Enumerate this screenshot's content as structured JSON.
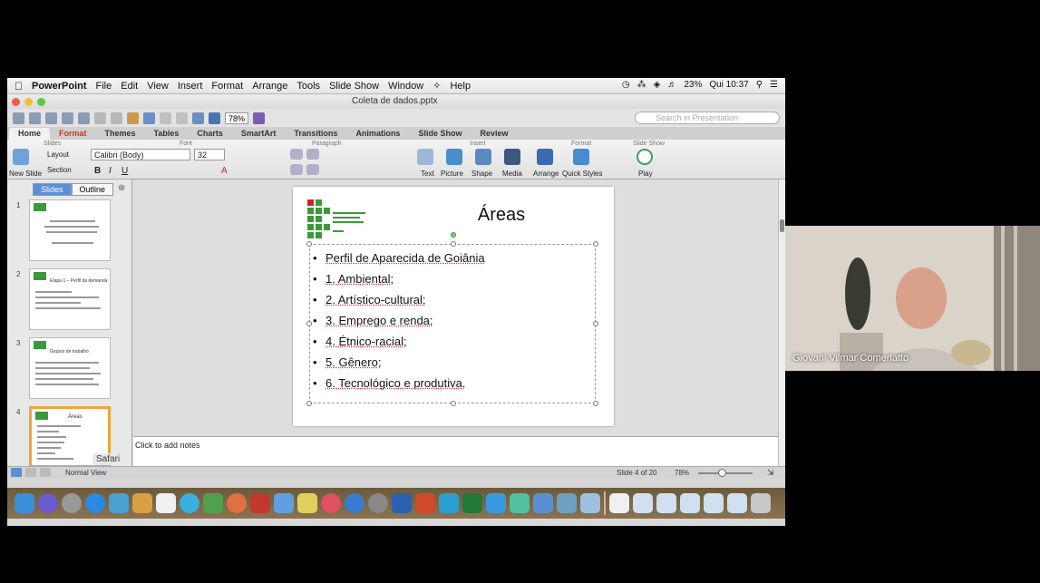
{
  "menubar": {
    "app": "PowerPoint",
    "items": [
      "File",
      "Edit",
      "View",
      "Insert",
      "Format",
      "Arrange",
      "Tools",
      "Slide Show",
      "Window",
      "Help"
    ],
    "battery": "23%",
    "clock": "Qui 10:37"
  },
  "window": {
    "doc_title": "Coleta de dados.pptx"
  },
  "toolbar": {
    "zoom": "78%",
    "search_placeholder": "Search in Presentation"
  },
  "ribbon": {
    "tabs": [
      "Home",
      "Format",
      "Themes",
      "Tables",
      "Charts",
      "SmartArt",
      "Transitions",
      "Animations",
      "Slide Show",
      "Review"
    ],
    "groups": {
      "slides": "Slides",
      "font": "Font",
      "paragraph": "Paragraph",
      "insert": "Insert",
      "format": "Format",
      "slideshow": "Slide Show"
    },
    "new_slide": "New Slide",
    "layout": "Layout",
    "section": "Section",
    "font_name": "Calibri (Body)",
    "font_size": "32",
    "text": "Text",
    "picture": "Picture",
    "shape": "Shape",
    "media": "Media",
    "arrange": "Arrange",
    "quick_styles": "Quick Styles",
    "play": "Play"
  },
  "thumbpane": {
    "tabs": [
      "Slides",
      "Outline"
    ],
    "thumbs": [
      {
        "num": "1",
        "title": ""
      },
      {
        "num": "2",
        "title": "Etapa 1 – Perfil da demanda"
      },
      {
        "num": "3",
        "title": "Grupos de trabalho"
      },
      {
        "num": "4",
        "title": "Áreas"
      }
    ]
  },
  "slide": {
    "title": "Áreas",
    "bullets": [
      "Perfil de Aparecida de Goiânia",
      "1. Ambiental;",
      "2. Artístico-cultural;",
      "3. Emprego e renda;",
      "4. Étnico-racial;",
      "5. Gênero;",
      "6. Tecnológico e produtiva."
    ]
  },
  "notes": {
    "placeholder": "Click to add notes"
  },
  "statusbar": {
    "view": "Normal View",
    "slide_of": "Slide 4 of 20",
    "zoom": "78%"
  },
  "dock": {
    "tooltip": "Safari"
  },
  "webcam": {
    "name": "Giovani Vilmar Comerlatto"
  },
  "colors": {
    "accent": "#5b8ed6",
    "current_slide_border": "#f0a33c",
    "logo_green": "#3a9a3a",
    "logo_red": "#c62828"
  }
}
